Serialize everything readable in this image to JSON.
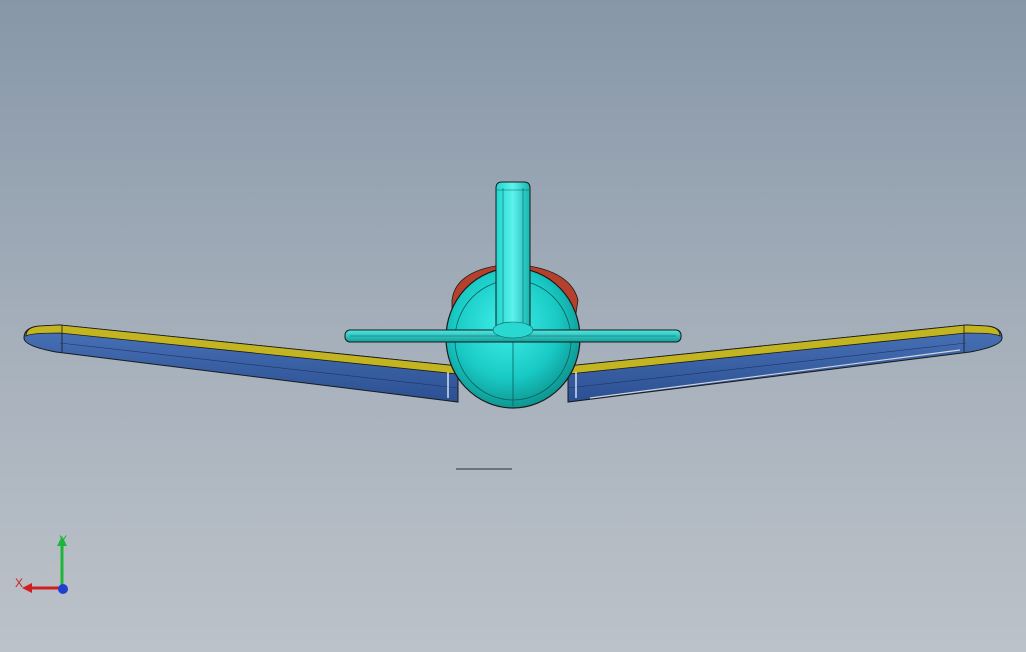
{
  "viewport": {
    "background_top": "#8797a8",
    "background_bottom": "#bcc2c9"
  },
  "model": {
    "colors": {
      "fuselage": "#19c9c4",
      "fuselage_shade": "#0e8f8c",
      "wing_lower": "#3d63a8",
      "wing_upper": "#c2b521",
      "stabilizer": "#2cc3bf",
      "accent_red": "#b5412c",
      "edge": "#1a1a1a"
    }
  },
  "triad": {
    "x_label": "X",
    "y_label": "Y",
    "x_color": "#d11f1f",
    "y_color": "#1fb53a",
    "z_color": "#1f3fd1"
  }
}
